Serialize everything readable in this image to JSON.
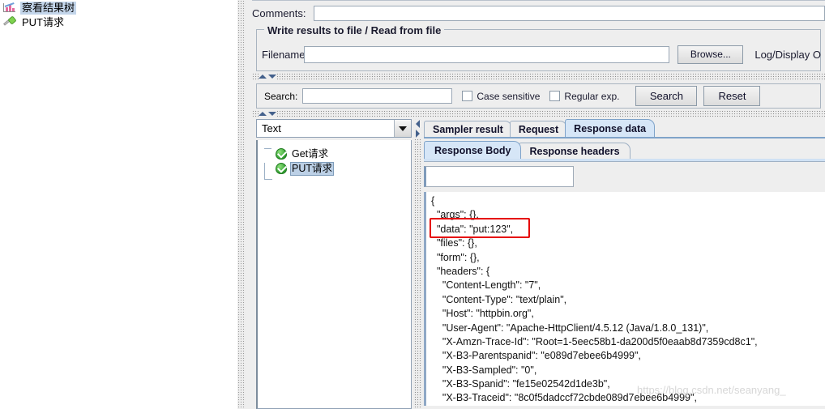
{
  "desktop_tree": {
    "items": [
      {
        "label": "察看结果树",
        "icon": "results-tree-listener-icon",
        "selected": true
      },
      {
        "label": "PUT请求",
        "icon": "http-sampler-icon",
        "selected": false
      }
    ]
  },
  "panel": {
    "comments": {
      "label": "Comments:",
      "value": "",
      "placeholder": ""
    },
    "file_group": {
      "title": "Write results to file / Read from file",
      "filename_label": "Filename",
      "filename_value": "",
      "browse_label": "Browse...",
      "log_display_label": "Log/Display O"
    },
    "search_bar": {
      "label": "Search:",
      "value": "",
      "case_sensitive_label": "Case sensitive",
      "case_sensitive_checked": false,
      "regular_exp_label": "Regular exp.",
      "regular_exp_checked": false,
      "search_button": "Search",
      "reset_button": "Reset"
    }
  },
  "results_tree": {
    "render_combo_value": "Text",
    "nodes": [
      {
        "label": "Get请求",
        "status": "success",
        "selected": false
      },
      {
        "label": "PUT请求",
        "status": "success",
        "selected": true
      }
    ]
  },
  "result_tabs": {
    "items": [
      {
        "label": "Sampler result",
        "active": false
      },
      {
        "label": "Request",
        "active": false
      },
      {
        "label": "Response data",
        "active": true
      }
    ]
  },
  "response_subtabs": {
    "items": [
      {
        "label": "Response Body",
        "active": true
      },
      {
        "label": "Response headers",
        "active": false
      }
    ]
  },
  "response_field_value": "",
  "response_body_lines": [
    "{",
    "  \"args\": {},",
    "  \"data\": \"put:123\",",
    "  \"files\": {},",
    "  \"form\": {},",
    "  \"headers\": {",
    "    \"Content-Length\": \"7\",",
    "    \"Content-Type\": \"text/plain\",",
    "    \"Host\": \"httpbin.org\",",
    "    \"User-Agent\": \"Apache-HttpClient/4.5.12 (Java/1.8.0_131)\",",
    "    \"X-Amzn-Trace-Id\": \"Root=1-5eec58b1-da200d5f0eaab8d7359cd8c1\",",
    "    \"X-B3-Parentspanid\": \"e089d7ebee6b4999\",",
    "    \"X-B3-Sampled\": \"0\",",
    "    \"X-B3-Spanid\": \"fe15e02542d1de3b\",",
    "    \"X-B3-Traceid\": \"8c0f5dadccf72cbde089d7ebee6b4999\","
  ],
  "annotation": {
    "highlight_target": "\"data\": \"put:123\",",
    "highlight_color": "#e60000"
  },
  "watermark": "https://blog.csdn.net/seanyang_"
}
